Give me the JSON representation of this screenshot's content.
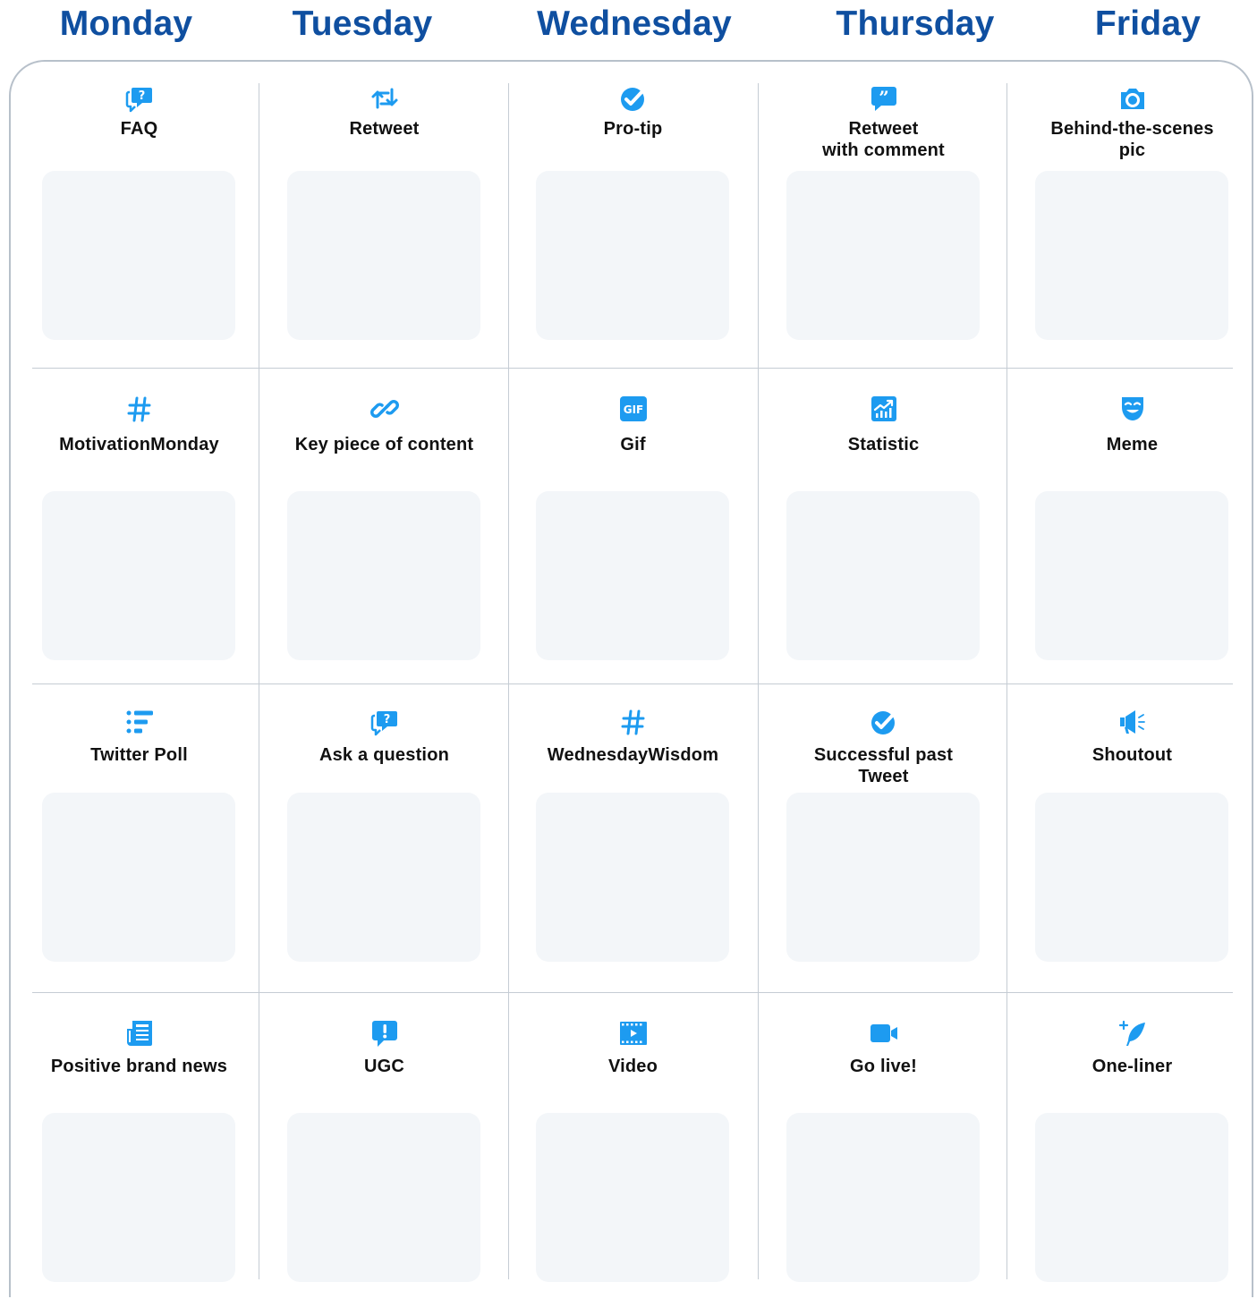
{
  "days": [
    "Monday",
    "Tuesday",
    "Wednesday",
    "Thursday",
    "Friday"
  ],
  "colors": {
    "day_heading": "#0f4fa0",
    "icon": "#1d9bf0",
    "card": "#f3f6f9",
    "grid": "#c5ccd4"
  },
  "rows": [
    [
      {
        "label": "FAQ",
        "icon": "question-bubble-icon"
      },
      {
        "label": "Retweet",
        "icon": "retweet-icon"
      },
      {
        "label": "Pro-tip",
        "icon": "check-badge-icon"
      },
      {
        "label": "Retweet\nwith comment",
        "icon": "quote-bubble-icon"
      },
      {
        "label": "Behind-the-scenes\npic",
        "icon": "camera-icon"
      }
    ],
    [
      {
        "label": "MotivationMonday",
        "icon": "hashtag-icon"
      },
      {
        "label": "Key piece of content",
        "icon": "link-icon"
      },
      {
        "label": "Gif",
        "icon": "gif-icon"
      },
      {
        "label": "Statistic",
        "icon": "chart-icon"
      },
      {
        "label": "Meme",
        "icon": "mask-icon"
      }
    ],
    [
      {
        "label": "Twitter Poll",
        "icon": "poll-icon"
      },
      {
        "label": "Ask a question",
        "icon": "question-bubble-icon"
      },
      {
        "label": "WednesdayWisdom",
        "icon": "hashtag-icon"
      },
      {
        "label": "Successful past\nTweet",
        "icon": "check-badge-icon"
      },
      {
        "label": "Shoutout",
        "icon": "megaphone-icon"
      }
    ],
    [
      {
        "label": "Positive brand news",
        "icon": "newspaper-icon"
      },
      {
        "label": "UGC",
        "icon": "exclamation-bubble-icon"
      },
      {
        "label": "Video",
        "icon": "film-icon"
      },
      {
        "label": "Go live!",
        "icon": "video-camera-icon"
      },
      {
        "label": "One-liner",
        "icon": "quill-icon"
      }
    ]
  ]
}
